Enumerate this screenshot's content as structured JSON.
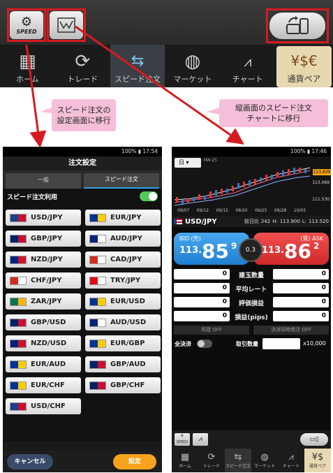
{
  "top": {
    "speed_label": "SPEED",
    "nav": [
      {
        "label": "ホーム",
        "icon": "grid-icon"
      },
      {
        "label": "トレード",
        "icon": "refresh-icon"
      },
      {
        "label": "スピード注文",
        "icon": "speed-arrows-icon"
      },
      {
        "label": "マーケット",
        "icon": "globe-icon"
      },
      {
        "label": "チャート",
        "icon": "chart-icon"
      },
      {
        "label": "通貨ペア",
        "icon": "currency-icon"
      }
    ],
    "speed_tag": "SPEED"
  },
  "callouts": {
    "left": "スピード注文の\n設定画面に移行",
    "right": "縦画面のスピード注文\nチャートに移行"
  },
  "left_screen": {
    "status": "100% ▮ 17:54",
    "title": "注文設定",
    "tabs": [
      "一般",
      "スピード注文"
    ],
    "toggle_label": "スピード注文利用",
    "pairs": [
      "USD/JPY",
      "EUR/JPY",
      "GBP/JPY",
      "AUD/JPY",
      "NZD/JPY",
      "CAD/JPY",
      "CHF/JPY",
      "TRY/JPY",
      "ZAR/JPY",
      "EUR/USD",
      "GBP/USD",
      "AUD/USD",
      "NZD/USD",
      "EUR/GBP",
      "EUR/AUD",
      "GBP/AUD",
      "EUR/CHF",
      "GBP/CHF",
      "USD/CHF"
    ],
    "cancel": "キャンセル",
    "ok": "設定"
  },
  "right_screen": {
    "status": "100% ▮ 17:46",
    "timeframe": "日",
    "ma": "MA:25",
    "price_hi": "113.839",
    "price_mid": "113.069",
    "price_lo": "111.530",
    "dates": [
      "09/07",
      "09/12",
      "09/15",
      "09/20",
      "09/25",
      "09/28",
      "10/03"
    ],
    "pair": "USD/JPY",
    "prev_label": "前日比",
    "prev_val": "242",
    "high_label": "H:",
    "high_val": "113.900",
    "low_label": "L:",
    "low_val": "113.520",
    "bid_label": "BID (売)",
    "ask_label": "(買) ASK",
    "bid_main": "113.",
    "bid_big": "85",
    "bid_small": "9",
    "ask_main": "113.",
    "ask_big": "86",
    "ask_small": "2",
    "spread": "0.3",
    "rows": [
      "建玉数量",
      "平均レート",
      "評価損益",
      "損益(pips)"
    ],
    "zero": "0",
    "both_btn": "両建 OFF",
    "settle_btn": "決済同時発注 OFF",
    "all_settle": "全決済",
    "qty_label": "取引数量",
    "unit": "x10,000",
    "nav": [
      "ホーム",
      "トレード",
      "スピード注文",
      "マーケット",
      "チャート",
      "通貨ペア"
    ]
  },
  "colors": {
    "bid": "#2e8fe0",
    "ask": "#e23b3b",
    "red_box": "#d61b20",
    "callout": "#f6bfd9",
    "toggle": "#53c957",
    "ok_btn": "#f7a21c"
  }
}
